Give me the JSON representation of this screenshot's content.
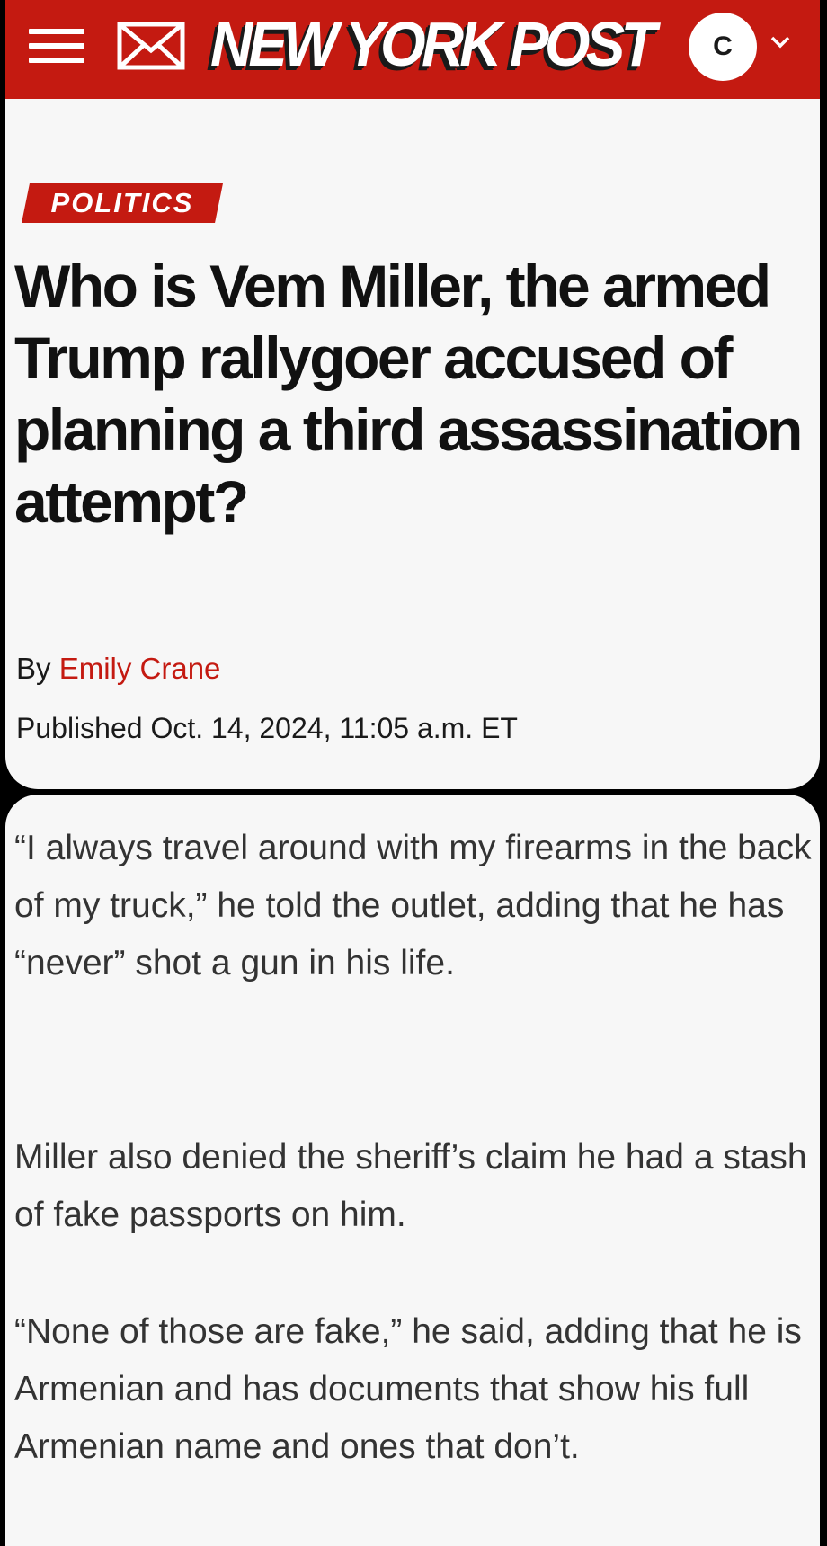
{
  "header": {
    "logo": "NEW YORK POST",
    "avatar_initial": "C",
    "brand_color": "#c41a11"
  },
  "icons": {
    "menu": "hamburger-menu-icon",
    "mail": "envelope-icon",
    "account_dropdown": "chevron-down-icon"
  },
  "article": {
    "section": "POLITICS",
    "headline": "Who is Vem Miller, the armed Trump rallygoer accused of planning a third assassination attempt?",
    "byline_prefix": "By ",
    "author": "Emily Crane",
    "published": "Published Oct. 14, 2024, 11:05 a.m. ET"
  },
  "body": {
    "paragraphs": [
      "“I always travel around with my firearms in the back of my truck,” he told the outlet, adding that he has “never” shot a gun in his life.",
      "Miller also denied the sheriff’s claim he had a stash of fake passports on him.",
      "“None of those are fake,” he said, adding that he is Armenian and has documents that show his full Armenian name and ones that don’t."
    ]
  }
}
